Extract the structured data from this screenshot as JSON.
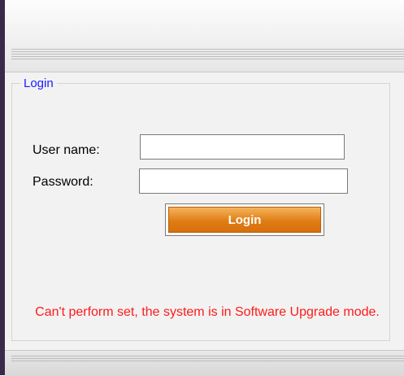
{
  "login": {
    "legend": "Login",
    "username_label": "User name:",
    "username_value": "",
    "password_label": "Password:",
    "password_value": "",
    "button_label": "Login",
    "error_message": "Can't perform set, the system is in Software Upgrade mode."
  },
  "colors": {
    "legend": "#1a1aff",
    "error": "#ff1a1a",
    "button": "#e07d15"
  }
}
